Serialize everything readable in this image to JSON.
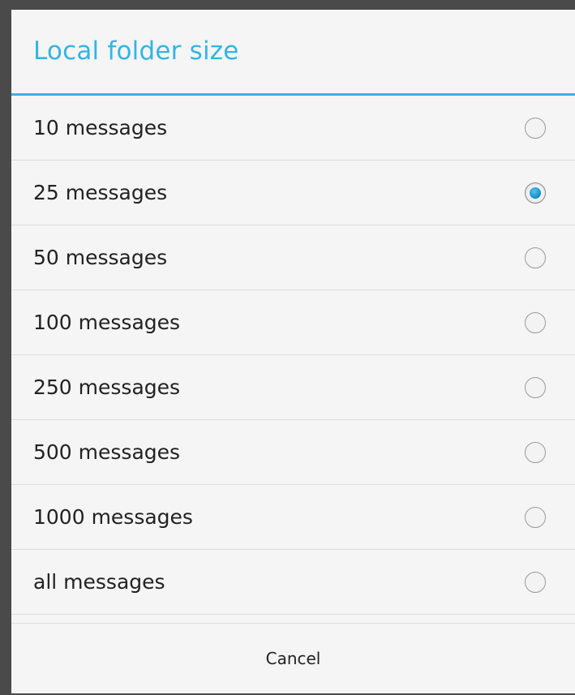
{
  "dialog": {
    "title": "Local folder size",
    "options": [
      {
        "label": "10 messages",
        "checked": false
      },
      {
        "label": "25 messages",
        "checked": true
      },
      {
        "label": "50 messages",
        "checked": false
      },
      {
        "label": "100 messages",
        "checked": false
      },
      {
        "label": "250 messages",
        "checked": false
      },
      {
        "label": "500 messages",
        "checked": false
      },
      {
        "label": "1000 messages",
        "checked": false
      },
      {
        "label": "all messages",
        "checked": false
      }
    ],
    "cancel_label": "Cancel"
  },
  "colors": {
    "accent": "#33b5e5",
    "radio_selected": "#1a8fc8",
    "backdrop": "#4a4a4a",
    "dialog_bg": "#f5f5f5"
  }
}
